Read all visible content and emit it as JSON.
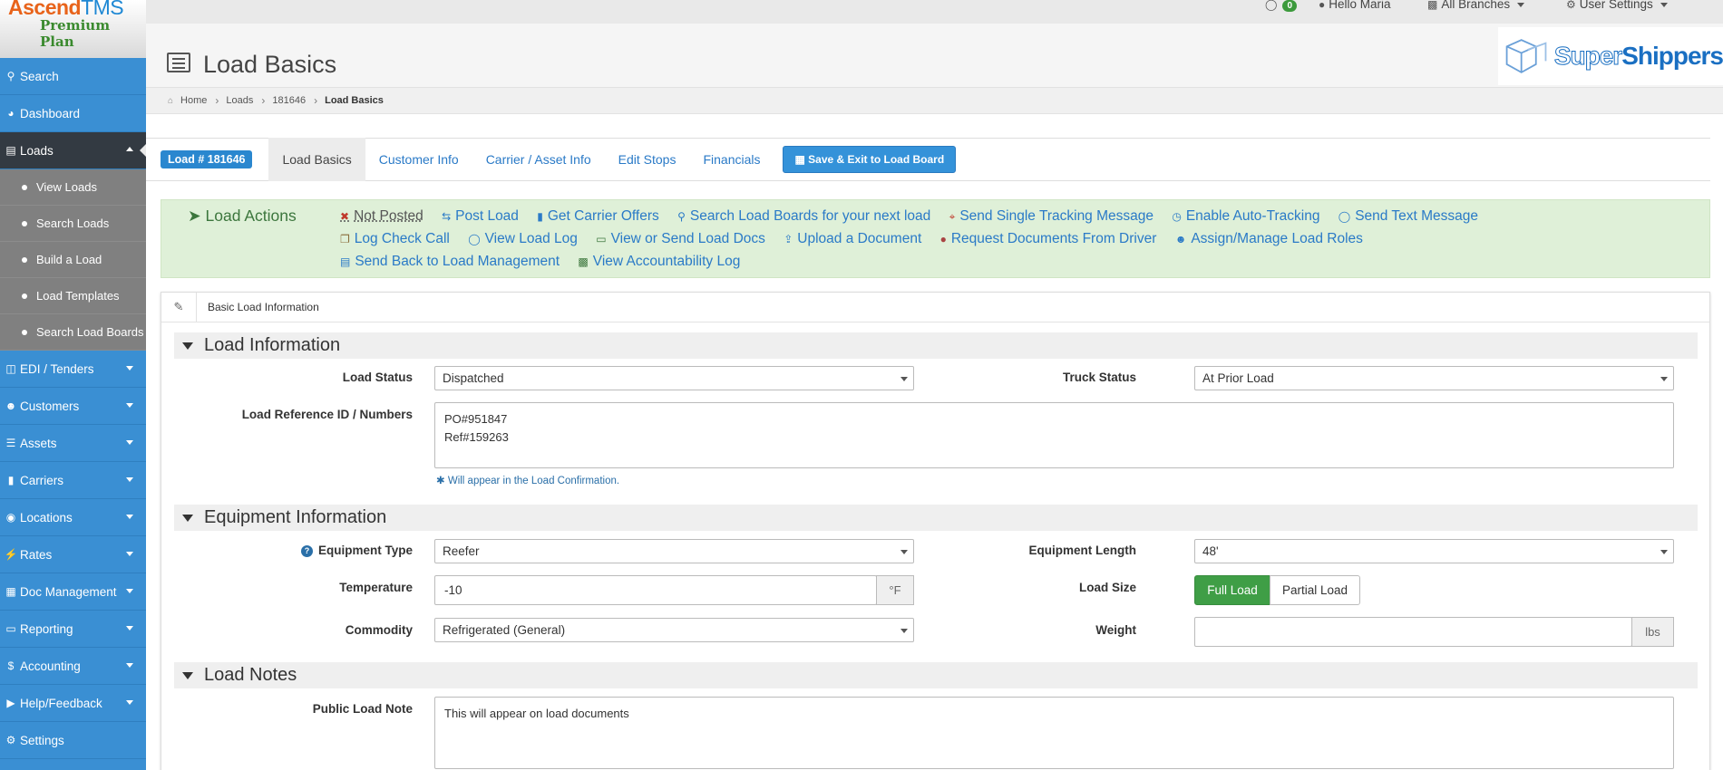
{
  "app": {
    "brand_ascend": "Ascend",
    "brand_tms": "TMS",
    "plan": "Premium Plan"
  },
  "sidebar": {
    "items": [
      {
        "label": "Search",
        "icon": "search-icon"
      },
      {
        "label": "Dashboard",
        "icon": "dashboard-icon"
      },
      {
        "label": "Loads",
        "icon": "list-icon"
      },
      {
        "label": "EDI / Tenders",
        "icon": "inbox-icon"
      },
      {
        "label": "Customers",
        "icon": "users-icon"
      },
      {
        "label": "Assets",
        "icon": "barcode-icon"
      },
      {
        "label": "Carriers",
        "icon": "truck-icon"
      },
      {
        "label": "Locations",
        "icon": "map-marker-icon"
      },
      {
        "label": "Rates",
        "icon": "bolt-icon"
      },
      {
        "label": "Doc Management",
        "icon": "folder-icon"
      },
      {
        "label": "Reporting",
        "icon": "file-icon"
      },
      {
        "label": "Accounting",
        "icon": "dollar-icon"
      },
      {
        "label": "Help/Feedback",
        "icon": "bullhorn-icon"
      },
      {
        "label": "Settings",
        "icon": "cogs-icon"
      }
    ],
    "load_subitems": [
      "View Loads",
      "Search Loads",
      "Build a Load",
      "Load Templates",
      "Search Load Boards"
    ]
  },
  "topbar": {
    "message_count": "0",
    "greeting": "Hello Maria",
    "branches": "All Branches",
    "user_settings": "User Settings"
  },
  "header": {
    "title": "Load Basics",
    "partner_logo_a": "Super",
    "partner_logo_b": "Shippers"
  },
  "breadcrumb": [
    "Home",
    "Loads",
    "181646",
    "Load Basics"
  ],
  "tabs": {
    "load_badge": "Load # 181646",
    "items": [
      "Load Basics",
      "Customer Info",
      "Carrier / Asset Info",
      "Edit Stops",
      "Financials"
    ],
    "save_label": "Save & Exit to Load Board"
  },
  "load_actions": {
    "title": "Load Actions",
    "row1": [
      "Not Posted",
      "Post Load",
      "Get Carrier Offers",
      "Search Load Boards for your next load",
      "Send Single Tracking Message",
      "Enable Auto-Tracking",
      "Send Text Message"
    ],
    "row2": [
      "Log Check Call",
      "View Load Log",
      "View or Send Load Docs",
      "Upload a Document",
      "Request Documents From Driver",
      "Assign/Manage Load Roles"
    ],
    "row3": [
      "Send Back to Load Management",
      "View Accountability Log"
    ]
  },
  "form": {
    "panel_title": "Basic Load Information",
    "sections": {
      "load_info": "Load Information",
      "equipment": "Equipment Information",
      "notes": "Load Notes"
    },
    "load_status_label": "Load Status",
    "load_status_value": "Dispatched",
    "truck_status_label": "Truck Status",
    "truck_status_value": "At Prior Load",
    "ref_label": "Load Reference ID / Numbers",
    "ref_line1": "PO#951847",
    "ref_line2": "Ref#159263",
    "ref_hint": "Will appear in the Load Confirmation.",
    "equipment_type_label": "Equipment Type",
    "equipment_type_value": "Reefer",
    "equipment_length_label": "Equipment Length",
    "equipment_length_value": "48'",
    "temperature_label": "Temperature",
    "temperature_value": "-10",
    "temperature_unit": "°F",
    "load_size_label": "Load Size",
    "load_size_full": "Full Load",
    "load_size_partial": "Partial Load",
    "commodity_label": "Commodity",
    "commodity_value": "Refrigerated (General)",
    "weight_label": "Weight",
    "weight_value": "",
    "weight_unit": "lbs",
    "public_note_label": "Public Load Note",
    "public_note_value": "This will appear on load documents"
  },
  "colors": {
    "sidebar": "#3a8fd3",
    "active_nav": "#333a42",
    "accent": "#2a87cf",
    "actions_bg": "#dff0d8",
    "success": "#3f9e46"
  }
}
